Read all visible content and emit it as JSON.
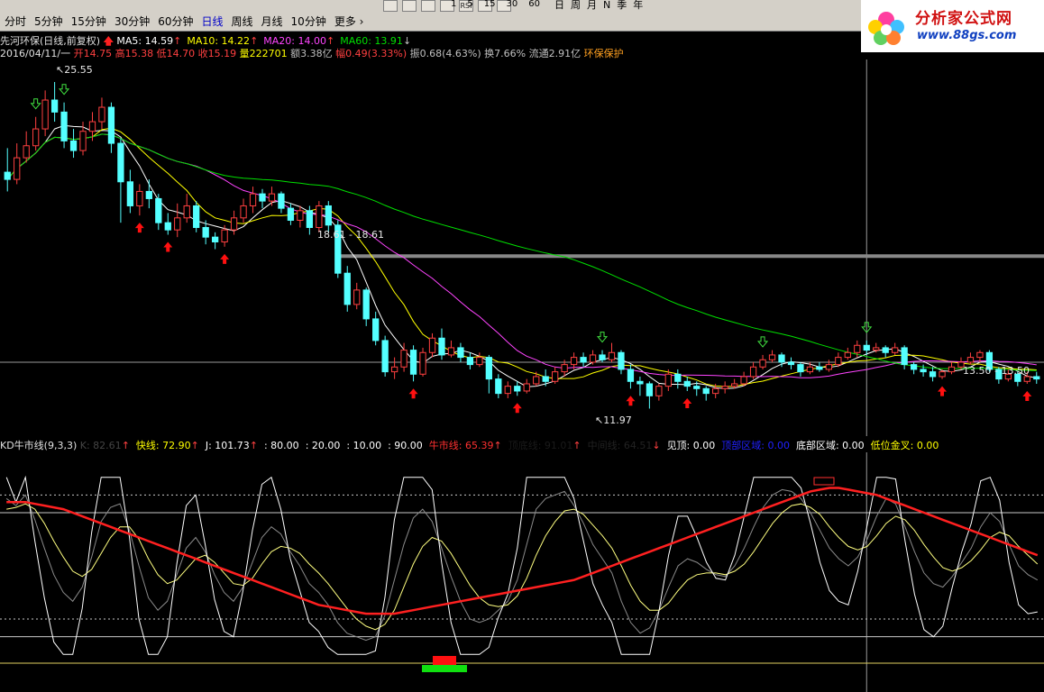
{
  "toolbar": {
    "period_tabs": [
      {
        "label": "分时",
        "active": false
      },
      {
        "label": "5分钟",
        "active": false
      },
      {
        "label": "15分钟",
        "active": false
      },
      {
        "label": "30分钟",
        "active": false
      },
      {
        "label": "60分钟",
        "active": false
      },
      {
        "label": "日线",
        "active": true
      },
      {
        "label": "周线",
        "active": false
      },
      {
        "label": "月线",
        "active": false
      },
      {
        "label": "10分钟",
        "active": false
      },
      {
        "label": "更多",
        "active": false
      }
    ],
    "icon_buttons": [
      "RSI"
    ],
    "number_buttons": [
      "1",
      "5",
      "15",
      "30",
      "60"
    ],
    "right_tabs": [
      "日",
      "周",
      "月",
      "N",
      "季",
      "年"
    ]
  },
  "logo": {
    "title": "分析家公式网",
    "url": "www.88gs.com"
  },
  "main_chart": {
    "stock_label": "先河环保(日线,前复权)",
    "ma": [
      {
        "label": "MA5: 14.59",
        "arrow": "↑",
        "color": "#ffffff"
      },
      {
        "label": "MA10: 14.22",
        "arrow": "↑",
        "color": "#ffff00"
      },
      {
        "label": "MA20: 14.00",
        "arrow": "↑",
        "color": "#ff44ff"
      },
      {
        "label": "MA60: 13.91",
        "arrow": "↓",
        "color": "#00e000"
      }
    ],
    "quote": {
      "date": "2016/04/11/一",
      "open": "开14.75",
      "high": "高15.38",
      "low": "低14.70",
      "close": "收15.19",
      "volume": "量222701",
      "amount": "额3.38亿",
      "change": "幅0.49(3.33%)",
      "amplitude": "振0.68(4.63%)",
      "turnover": "换7.66%",
      "float": "流通2.91亿",
      "sector": "环保保护"
    },
    "price_labels": {
      "high": "25.55",
      "range": "18.61 - 18.61",
      "low": "11.97",
      "right": "13.50 - 13.50"
    }
  },
  "indicator": {
    "name": "KD牛市线(9,3,3)",
    "items": [
      {
        "label": "K: 82.61",
        "arrow": "↑",
        "color": "#444444"
      },
      {
        "label": "快线: 72.90",
        "arrow": "↑",
        "color": "#ffff00"
      },
      {
        "label": "J: 101.73",
        "arrow": "↑",
        "color": "#ffffff"
      },
      {
        "label": ": 80.00",
        "arrow": "",
        "color": "#ffffff"
      },
      {
        "label": ": 20.00",
        "arrow": "",
        "color": "#ffffff"
      },
      {
        "label": ": 10.00",
        "arrow": "",
        "color": "#ffffff"
      },
      {
        "label": ": 90.00",
        "arrow": "",
        "color": "#ffffff"
      },
      {
        "label": "牛市线: 65.39",
        "arrow": "↑",
        "color": "#ff3030"
      },
      {
        "label": "顶底线: 91.01",
        "arrow": "↑",
        "color": "#1a1a1a"
      },
      {
        "label": "中间线: 64.51",
        "arrow": "↓",
        "color": "#222222"
      },
      {
        "label": "见顶: 0.00",
        "arrow": "",
        "color": "#ffffff"
      },
      {
        "label": "顶部区域: 0.00",
        "arrow": "",
        "color": "#2020ff"
      },
      {
        "label": "底部区域: 0.00",
        "arrow": "",
        "color": "#ffffff"
      },
      {
        "label": "低位金叉: 0.00",
        "arrow": "",
        "color": "#ffff00"
      }
    ]
  },
  "chart_data": {
    "type": "candlestick",
    "ma_periods": [
      5,
      10,
      20,
      60
    ],
    "candles": [
      [
        21.8,
        21.5,
        22.8,
        21.0
      ],
      [
        21.5,
        22.4,
        23.0,
        21.3
      ],
      [
        22.4,
        22.9,
        23.5,
        22.2
      ],
      [
        22.9,
        23.6,
        24.1,
        22.7
      ],
      [
        23.6,
        24.8,
        25.2,
        23.3
      ],
      [
        24.8,
        24.3,
        25.55,
        23.9
      ],
      [
        24.3,
        23.1,
        24.7,
        22.8
      ],
      [
        23.1,
        22.7,
        23.6,
        22.4
      ],
      [
        22.7,
        23.5,
        23.9,
        22.5
      ],
      [
        23.5,
        23.9,
        24.3,
        23.1
      ],
      [
        23.9,
        24.5,
        24.9,
        23.6
      ],
      [
        24.5,
        23.0,
        24.7,
        22.6
      ],
      [
        23.0,
        21.4,
        23.2,
        19.7
      ],
      [
        21.4,
        20.4,
        21.9,
        20.1
      ],
      [
        20.4,
        21.0,
        21.3,
        20.0
      ],
      [
        21.0,
        20.7,
        21.5,
        20.3
      ],
      [
        20.7,
        19.7,
        20.9,
        19.4
      ],
      [
        19.7,
        19.4,
        20.1,
        19.2
      ],
      [
        19.4,
        19.9,
        20.5,
        19.1
      ],
      [
        19.9,
        20.4,
        20.9,
        19.7
      ],
      [
        20.4,
        19.5,
        20.6,
        19.3
      ],
      [
        19.5,
        19.1,
        19.8,
        18.8
      ],
      [
        19.1,
        18.9,
        19.3,
        18.6
      ],
      [
        18.9,
        19.4,
        19.6,
        18.7
      ],
      [
        19.4,
        19.9,
        20.2,
        19.2
      ],
      [
        19.9,
        20.4,
        20.7,
        19.7
      ],
      [
        20.4,
        20.9,
        21.2,
        20.1
      ],
      [
        20.9,
        20.6,
        21.1,
        20.3
      ],
      [
        20.6,
        20.9,
        21.2,
        20.4
      ],
      [
        20.9,
        20.3,
        21.0,
        20.1
      ],
      [
        20.3,
        19.8,
        20.5,
        19.6
      ],
      [
        19.8,
        20.2,
        20.4,
        19.5
      ],
      [
        20.2,
        19.5,
        20.4,
        19.2
      ],
      [
        19.5,
        20.4,
        20.6,
        19.3
      ],
      [
        20.4,
        19.6,
        20.6,
        19.3
      ],
      [
        19.6,
        17.6,
        19.8,
        17.4
      ],
      [
        17.6,
        16.3,
        17.9,
        16.0
      ],
      [
        16.3,
        16.9,
        17.2,
        16.1
      ],
      [
        16.9,
        15.7,
        17.0,
        15.4
      ],
      [
        15.7,
        14.8,
        16.0,
        14.6
      ],
      [
        14.8,
        13.5,
        15.0,
        13.3
      ],
      [
        13.5,
        13.7,
        14.1,
        13.2
      ],
      [
        13.7,
        14.4,
        14.7,
        13.5
      ],
      [
        14.4,
        13.4,
        14.6,
        13.1
      ],
      [
        13.4,
        14.3,
        14.5,
        13.3
      ],
      [
        14.3,
        14.9,
        15.1,
        14.1
      ],
      [
        14.9,
        14.2,
        15.3,
        14.0
      ],
      [
        14.2,
        14.5,
        14.8,
        14.1
      ],
      [
        14.5,
        14.1,
        14.7,
        13.9
      ],
      [
        14.1,
        13.8,
        14.3,
        13.6
      ],
      [
        13.8,
        14.1,
        14.3,
        13.7
      ],
      [
        14.1,
        13.2,
        14.2,
        12.6
      ],
      [
        13.2,
        12.6,
        13.4,
        12.4
      ],
      [
        12.6,
        12.9,
        13.1,
        12.4
      ],
      [
        12.9,
        12.7,
        13.1,
        12.5
      ],
      [
        12.7,
        13.0,
        13.2,
        12.6
      ],
      [
        13.0,
        13.3,
        13.5,
        12.9
      ],
      [
        13.3,
        13.1,
        13.6,
        12.9
      ],
      [
        13.1,
        13.5,
        13.7,
        13.0
      ],
      [
        13.5,
        13.8,
        14.0,
        13.3
      ],
      [
        13.8,
        14.1,
        14.3,
        13.6
      ],
      [
        14.1,
        13.9,
        14.3,
        13.7
      ],
      [
        13.9,
        14.2,
        14.4,
        13.8
      ],
      [
        14.2,
        14.0,
        14.4,
        13.9
      ],
      [
        14.0,
        14.3,
        14.7,
        13.9
      ],
      [
        14.3,
        13.6,
        14.4,
        13.4
      ],
      [
        13.6,
        13.1,
        13.8,
        12.8
      ],
      [
        13.1,
        13.0,
        13.3,
        12.5
      ],
      [
        13.0,
        12.5,
        13.1,
        11.97
      ],
      [
        12.5,
        12.9,
        13.0,
        12.3
      ],
      [
        12.9,
        13.4,
        13.6,
        12.7
      ],
      [
        13.4,
        13.1,
        13.6,
        12.8
      ],
      [
        13.1,
        12.9,
        13.3,
        12.7
      ],
      [
        12.9,
        12.8,
        13.1,
        12.5
      ],
      [
        12.8,
        12.6,
        12.9,
        12.3
      ],
      [
        12.6,
        12.8,
        13.0,
        12.4
      ],
      [
        12.8,
        12.9,
        13.1,
        12.6
      ],
      [
        12.9,
        13.0,
        13.2,
        12.8
      ],
      [
        13.0,
        13.3,
        13.5,
        12.9
      ],
      [
        13.3,
        13.7,
        13.9,
        13.2
      ],
      [
        13.7,
        14.0,
        14.2,
        13.6
      ],
      [
        14.0,
        14.2,
        14.4,
        13.9
      ],
      [
        14.2,
        13.9,
        14.3,
        13.7
      ],
      [
        13.9,
        13.8,
        14.1,
        13.6
      ],
      [
        13.8,
        13.5,
        13.9,
        13.3
      ],
      [
        13.5,
        13.7,
        13.9,
        13.4
      ],
      [
        13.7,
        13.6,
        13.9,
        13.5
      ],
      [
        13.6,
        13.8,
        14.0,
        13.5
      ],
      [
        13.8,
        14.1,
        14.3,
        13.7
      ],
      [
        14.1,
        14.3,
        14.5,
        14.0
      ],
      [
        14.3,
        14.6,
        14.8,
        14.1
      ],
      [
        14.6,
        14.4,
        14.8,
        14.2
      ],
      [
        14.4,
        14.5,
        14.7,
        14.3
      ],
      [
        14.5,
        14.3,
        14.6,
        14.1
      ],
      [
        14.3,
        14.5,
        14.7,
        14.2
      ],
      [
        14.5,
        13.8,
        14.6,
        13.6
      ],
      [
        13.8,
        13.6,
        13.9,
        13.4
      ],
      [
        13.6,
        13.5,
        13.8,
        13.3
      ],
      [
        13.5,
        13.3,
        13.7,
        13.1
      ],
      [
        13.3,
        13.5,
        13.6,
        13.2
      ],
      [
        13.5,
        13.7,
        13.9,
        13.4
      ],
      [
        13.7,
        13.9,
        14.1,
        13.6
      ],
      [
        13.9,
        14.1,
        14.3,
        13.8
      ],
      [
        14.1,
        14.3,
        14.4,
        13.9
      ],
      [
        14.3,
        13.6,
        14.4,
        13.5
      ],
      [
        13.6,
        13.2,
        13.7,
        13.0
      ],
      [
        13.2,
        13.4,
        13.6,
        13.1
      ],
      [
        13.4,
        13.1,
        13.5,
        12.9
      ],
      [
        13.1,
        13.3,
        13.5,
        13.0
      ],
      [
        13.3,
        13.2,
        13.5,
        13.0
      ]
    ],
    "buy_signals": [
      14,
      17,
      23,
      43,
      54,
      66,
      72,
      99,
      108
    ],
    "sell_signals": [
      3,
      6,
      63,
      80,
      91
    ],
    "hline_price": 13.9,
    "range_line_price": 18.61,
    "crosshair_index": 91,
    "kd": {
      "k": [
        88,
        84,
        90,
        76,
        60,
        45,
        35,
        30,
        38,
        55,
        75,
        83,
        85,
        70,
        50,
        32,
        25,
        30,
        45,
        60,
        66,
        58,
        45,
        35,
        30,
        38,
        52,
        66,
        72,
        68,
        58,
        50,
        40,
        35,
        28,
        18,
        12,
        10,
        8,
        10,
        22,
        42,
        62,
        77,
        82,
        75,
        60,
        44,
        30,
        20,
        18,
        20,
        25,
        30,
        42,
        62,
        82,
        88,
        90,
        92,
        84,
        74,
        62,
        54,
        46,
        30,
        18,
        12,
        15,
        25,
        38,
        50,
        54,
        52,
        48,
        45,
        44,
        50,
        60,
        72,
        83,
        90,
        93,
        92,
        88,
        80,
        70,
        60,
        54,
        50,
        55,
        65,
        78,
        88,
        85,
        72,
        58,
        46,
        40,
        38,
        44,
        52,
        60,
        72,
        80,
        75,
        62,
        50,
        45,
        42
      ],
      "d": [
        82,
        83,
        85,
        82,
        74,
        64,
        55,
        47,
        44,
        48,
        57,
        66,
        72,
        72,
        65,
        54,
        45,
        40,
        42,
        48,
        54,
        56,
        52,
        46,
        40,
        39,
        43,
        51,
        58,
        61,
        60,
        57,
        51,
        46,
        40,
        33,
        26,
        20,
        16,
        14,
        17,
        25,
        38,
        51,
        61,
        66,
        64,
        57,
        48,
        39,
        32,
        28,
        27,
        28,
        33,
        43,
        56,
        67,
        75,
        81,
        82,
        79,
        73,
        67,
        60,
        50,
        39,
        30,
        25,
        25,
        29,
        36,
        42,
        45,
        46,
        46,
        45,
        47,
        51,
        58,
        66,
        74,
        80,
        84,
        85,
        83,
        79,
        72,
        66,
        61,
        59,
        61,
        67,
        74,
        78,
        76,
        70,
        62,
        55,
        49,
        47,
        49,
        53,
        59,
        66,
        69,
        67,
        61,
        56,
        51
      ],
      "j": [
        100,
        86,
        100,
        64,
        32,
        7,
        0,
        0,
        26,
        69,
        100,
        100,
        100,
        66,
        20,
        0,
        0,
        10,
        51,
        84,
        90,
        62,
        31,
        13,
        10,
        36,
        70,
        96,
        100,
        82,
        54,
        36,
        18,
        13,
        4,
        0,
        0,
        0,
        0,
        2,
        32,
        76,
        100,
        100,
        100,
        93,
        52,
        18,
        0,
        0,
        0,
        4,
        21,
        34,
        60,
        100,
        100,
        100,
        100,
        100,
        88,
        64,
        40,
        28,
        18,
        0,
        0,
        0,
        0,
        25,
        56,
        78,
        78,
        66,
        52,
        43,
        42,
        56,
        78,
        100,
        100,
        100,
        100,
        100,
        94,
        74,
        52,
        36,
        30,
        28,
        47,
        73,
        100,
        100,
        99,
        64,
        34,
        14,
        10,
        16,
        38,
        58,
        74,
        98,
        100,
        87,
        52,
        28,
        23,
        24
      ],
      "bull": [
        86,
        86,
        86,
        85,
        84,
        83,
        82,
        80,
        78,
        76,
        74,
        72,
        70,
        68,
        66,
        64,
        62,
        60,
        58,
        56,
        54,
        52,
        50,
        48,
        46,
        44,
        42,
        40,
        38,
        36,
        34,
        32,
        30,
        28,
        27,
        26,
        25,
        24,
        23,
        23,
        23,
        23,
        24,
        25,
        26,
        27,
        28,
        29,
        30,
        31,
        32,
        33,
        34,
        35,
        36,
        37,
        38,
        39,
        40,
        41,
        42,
        44,
        46,
        48,
        50,
        52,
        54,
        56,
        58,
        60,
        62,
        64,
        66,
        68,
        70,
        72,
        74,
        76,
        78,
        80,
        82,
        84,
        86,
        88,
        90,
        92,
        93,
        94,
        94,
        93,
        92,
        91,
        90,
        88,
        86,
        84,
        82,
        80,
        78,
        76,
        74,
        72,
        70,
        68,
        66,
        64,
        62,
        60,
        58,
        56
      ],
      "levels": [
        80,
        20,
        10,
        90
      ]
    }
  }
}
